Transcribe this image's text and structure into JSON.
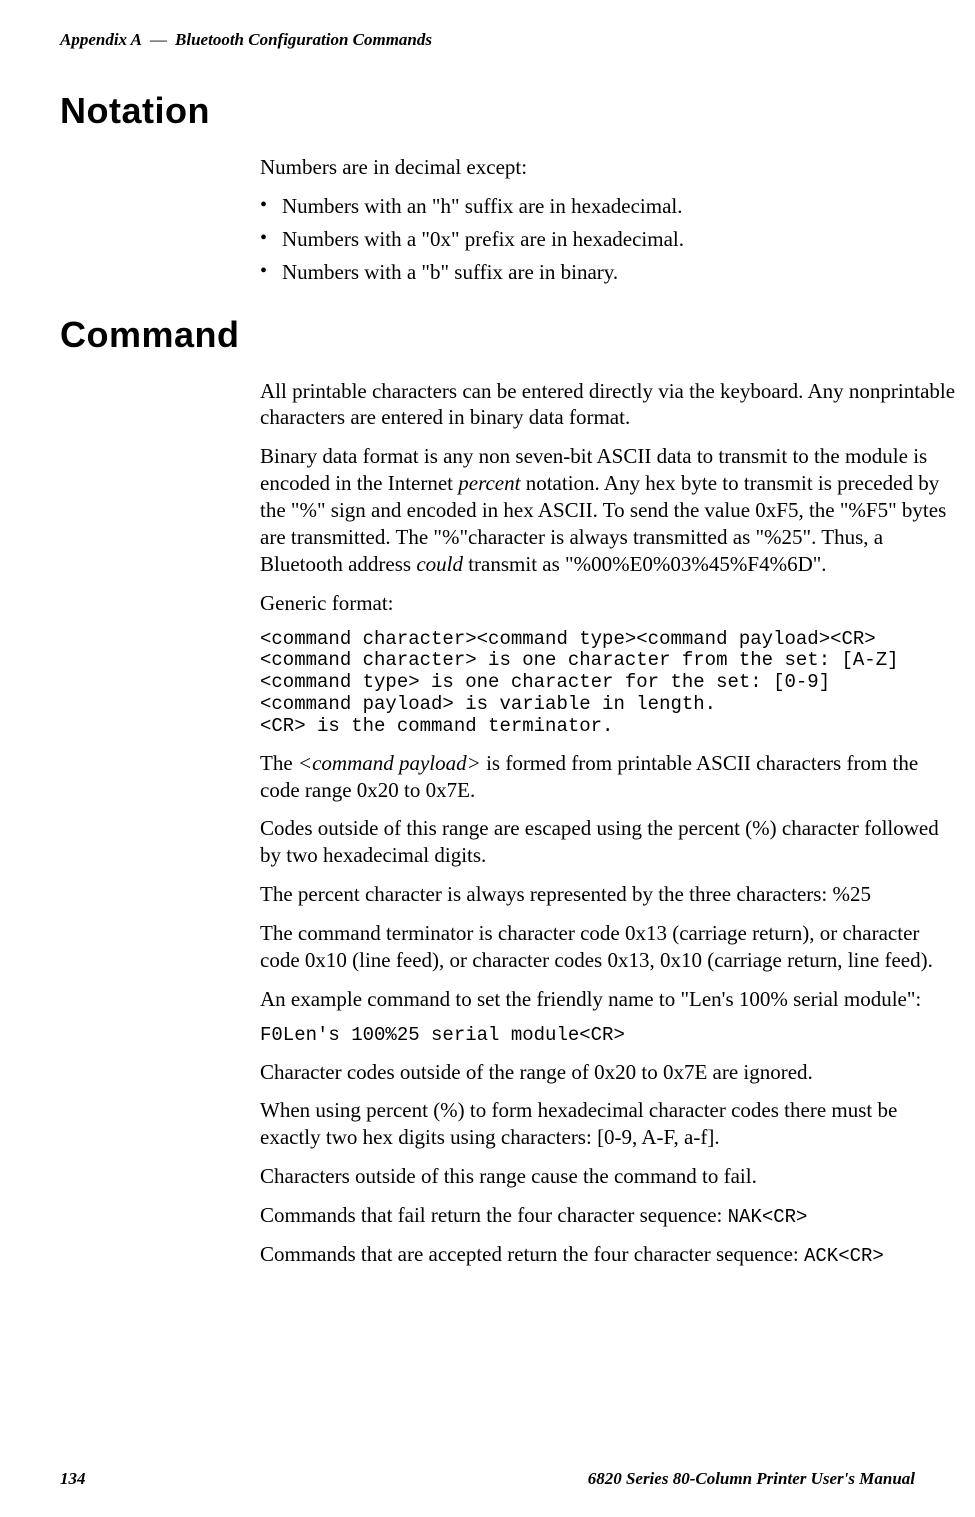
{
  "running_head": {
    "prefix": "Appendix  A",
    "sep": "—",
    "title": "Bluetooth Configuration Commands"
  },
  "sections": {
    "notation": {
      "heading": "Notation",
      "intro": "Numbers are in decimal except:",
      "bullets": [
        "Numbers with an \"h\" suffix are in hexadecimal.",
        "Numbers with a \"0x\" prefix are in hexadecimal.",
        "Numbers with a \"b\" suffix are in binary."
      ]
    },
    "command": {
      "heading": "Command",
      "p1": "All printable characters can be entered directly via the keyboard. Any nonprintable characters are entered in binary data format.",
      "p2a": "Binary data format is any non seven-bit ASCII data to transmit to the module is encoded in the Internet ",
      "p2_em1": "percent",
      "p2b": " notation. Any hex byte to transmit is preceded by the \"%\" sign and encoded in hex ASCII. To send the value 0xF5, the \"%F5\" bytes are transmitted. The \"%\"character is always transmitted as \"%25\". Thus, a Bluetooth address ",
      "p2_em2": "could",
      "p2c": " transmit as \"%00%E0%03%45%F4%6D\".",
      "generic_label": "Generic format:",
      "code1": "<command character><command type><command payload><CR>\n<command character> is one character from the set: [A-Z]\n<command type> is one character for the set: [0-9]\n<command payload> is variable in length.\n<CR> is the command terminator.",
      "p3a": "The ",
      "p3_em": "<command payload>",
      "p3b": " is formed from printable ASCII characters from the code range 0x20 to 0x7E.",
      "p4": "Codes outside of this range are escaped using the percent (%) character followed by two hexadecimal digits.",
      "p5": "The percent character is always represented by the three characters: %25",
      "p6": "The command terminator is character code 0x13 (carriage return), or character code 0x10 (line feed), or character codes 0x13, 0x10 (carriage return, line feed).",
      "p7": "An example command to set the friendly name to \"Len's 100% serial module\":",
      "code2": "F0Len's 100%25 serial module<CR>",
      "p8": "Character codes outside of the range of 0x20 to 0x7E are ignored.",
      "p9": "When using percent (%) to form hexadecimal character codes there must be exactly two hex digits using characters: [0-9, A-F, a-f].",
      "p10": "Characters outside of this range cause the command to fail.",
      "p11a": "Commands that fail return the four character sequence: ",
      "p11_code": "NAK<CR>",
      "p12a": "Commands that are accepted return the four character sequence: ",
      "p12_code": "ACK<CR>"
    }
  },
  "footer": {
    "page": "134",
    "title": "6820 Series 80-Column Printer User's Manual"
  }
}
